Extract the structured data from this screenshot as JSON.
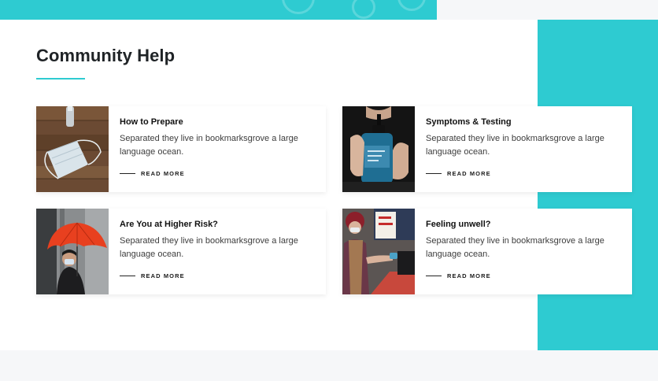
{
  "page": {
    "title": "Community Help",
    "accent_color": "#2ecbd1"
  },
  "cards": [
    {
      "heading": "How to Prepare",
      "description": "Separated they live in bookmarksgrove a large language ocean.",
      "link_label": "READ MORE",
      "image": "face-mask-and-sanitizer-photo"
    },
    {
      "heading": "Symptoms & Testing",
      "description": "Separated they live in bookmarksgrove a large language ocean.",
      "link_label": "READ MORE",
      "image": "hand-sanitizer-bottle-photo"
    },
    {
      "heading": "Are You at Higher Risk?",
      "description": "Separated they live in bookmarksgrove a large language ocean.",
      "link_label": "READ MORE",
      "image": "person-with-red-umbrella-photo"
    },
    {
      "heading": "Feeling unwell?",
      "description": "Separated they live in bookmarksgrove a large language ocean.",
      "link_label": "READ MORE",
      "image": "street-sanitizer-handout-photo"
    }
  ]
}
